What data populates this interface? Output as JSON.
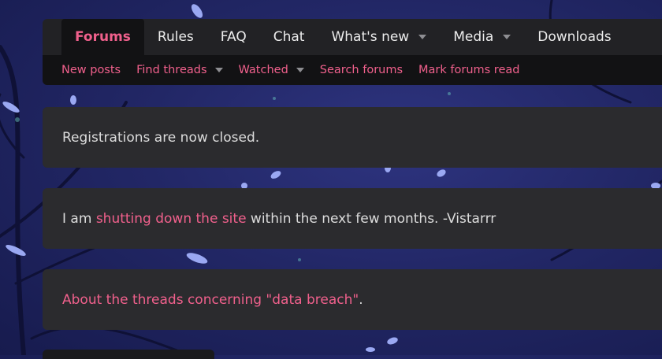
{
  "nav": {
    "tabs": [
      {
        "label": "Forums",
        "active": true,
        "dropdown": false
      },
      {
        "label": "Rules",
        "active": false,
        "dropdown": false
      },
      {
        "label": "FAQ",
        "active": false,
        "dropdown": false
      },
      {
        "label": "Chat",
        "active": false,
        "dropdown": false
      },
      {
        "label": "What's new",
        "active": false,
        "dropdown": true
      },
      {
        "label": "Media",
        "active": false,
        "dropdown": true
      },
      {
        "label": "Downloads",
        "active": false,
        "dropdown": false
      }
    ],
    "sub_links": [
      {
        "label": "New posts",
        "dropdown": false
      },
      {
        "label": "Find threads",
        "dropdown": true
      },
      {
        "label": "Watched",
        "dropdown": true
      },
      {
        "label": "Search forums",
        "dropdown": false
      },
      {
        "label": "Mark forums read",
        "dropdown": false
      }
    ]
  },
  "notices": {
    "registration": "Registrations are now closed.",
    "shutdown_prefix": "I am ",
    "shutdown_link": "shutting down the site",
    "shutdown_suffix": " within the next few months. -Vistarrr",
    "breach_link": "About the threads concerning \"data breach\"",
    "breach_suffix": "."
  },
  "colors": {
    "accent": "#f0608c",
    "nav_bg": "#222225",
    "subnav_bg": "#121214",
    "notice_bg": "#2b2b2e",
    "text": "#dcdcdc"
  }
}
